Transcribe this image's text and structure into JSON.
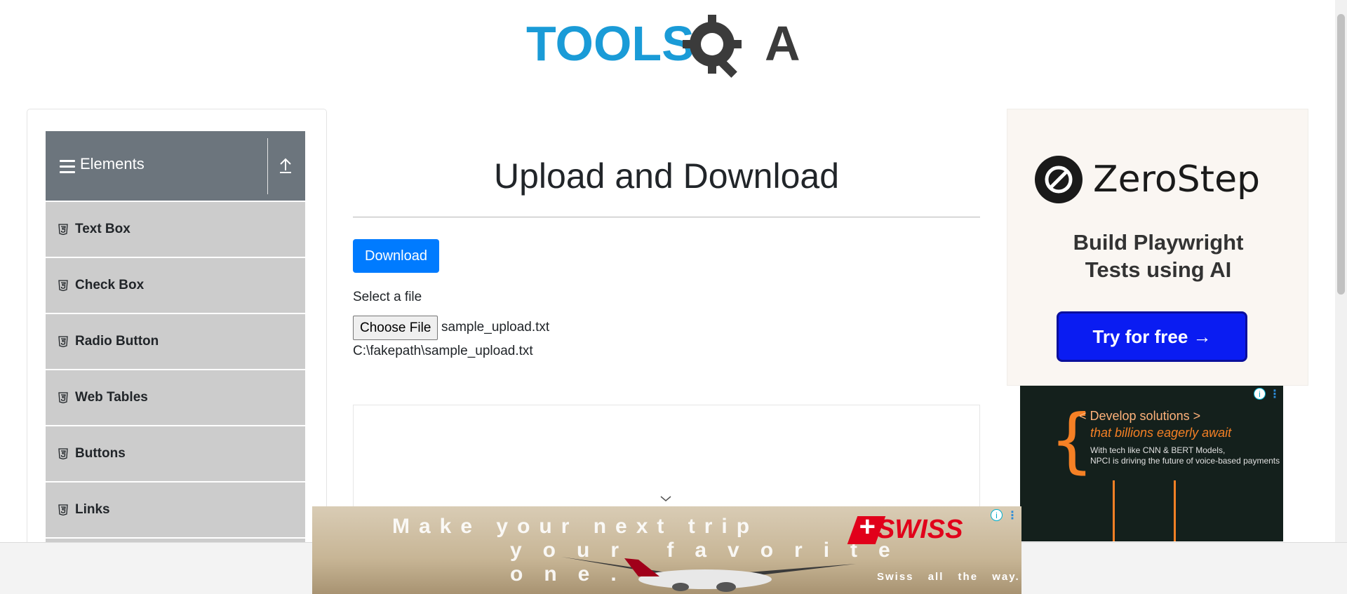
{
  "header": {
    "logo_text_left": "TOOLS",
    "logo_text_right": "A"
  },
  "sidebar": {
    "group_title": "Elements",
    "items": [
      {
        "label": "Text Box"
      },
      {
        "label": "Check Box"
      },
      {
        "label": "Radio Button"
      },
      {
        "label": "Web Tables"
      },
      {
        "label": "Buttons"
      },
      {
        "label": "Links"
      }
    ]
  },
  "main": {
    "title": "Upload and Download",
    "download_label": "Download",
    "select_label": "Select a file",
    "choose_file_label": "Choose File",
    "file_name": "sample_upload.txt",
    "file_path": "C:\\fakepath\\sample_upload.txt"
  },
  "right_ad": {
    "brand": "ZeroStep",
    "tagline_1": "Build Playwright",
    "tagline_2": "Tests using AI",
    "cta": "Try for free →"
  },
  "right_ad2": {
    "line1": "< Develop solutions >",
    "line2": "that billions eagerly await",
    "line3": "With tech like CNN & BERT Models,",
    "line4": "NPCI is driving the future of voice-based payments"
  },
  "bottom_ad": {
    "line1": "Make your next trip",
    "line2": "your favorite one.",
    "brand": "SWISS",
    "slogan": "Swiss all the way."
  },
  "colors": {
    "accent": "#007bff",
    "sidebar_header": "#6c757d",
    "sidebar_item": "#cccccc",
    "zerostep_cta": "#0a1cf2",
    "swiss_red": "#e1001a"
  }
}
